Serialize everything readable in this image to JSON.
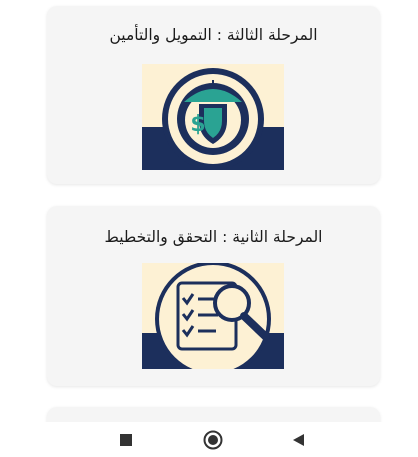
{
  "cards": [
    {
      "title": "المرحلة الثالثة : التمويل والتأمين",
      "image_icon": "shield-umbrella-dollar-icon"
    },
    {
      "title": "المرحلة الثانية : التحقق والتخطيط",
      "image_icon": "checklist-magnifier-icon"
    }
  ],
  "colors": {
    "card_bg": "#f5f5f5",
    "navy": "#1c2f5c",
    "cream": "#fdf1d4",
    "teal": "#2aa393",
    "nav_icon": "#333333"
  },
  "nav_bar": {
    "icons": [
      "recents-square-icon",
      "home-circle-icon",
      "back-triangle-icon"
    ]
  }
}
